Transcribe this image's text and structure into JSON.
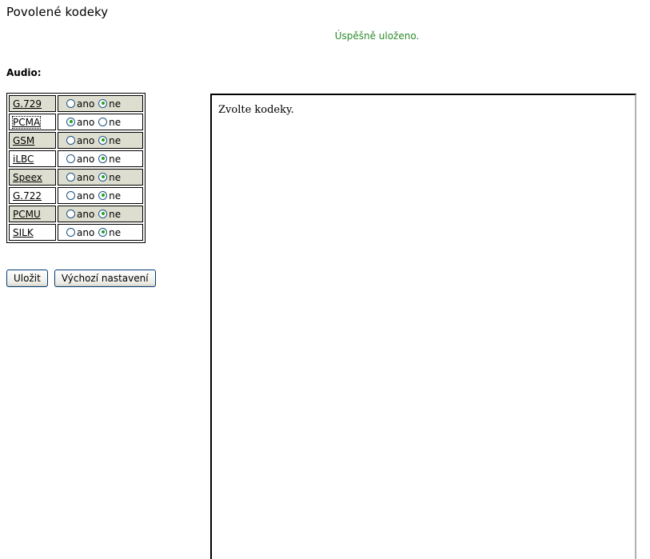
{
  "page": {
    "title": "Povolené kodeky",
    "status_message": "Úspěšně uloženo.",
    "status_color": "#2a8a2a"
  },
  "audio": {
    "section_title": "Audio:",
    "option_yes": "ano",
    "option_no": "ne",
    "codecs": [
      {
        "name": "G.729",
        "enabled": false
      },
      {
        "name": "PCMA",
        "enabled": true
      },
      {
        "name": "GSM",
        "enabled": false
      },
      {
        "name": "iLBC",
        "enabled": false
      },
      {
        "name": "Speex",
        "enabled": false
      },
      {
        "name": "G.722",
        "enabled": false
      },
      {
        "name": "PCMU",
        "enabled": false
      },
      {
        "name": "SILK",
        "enabled": false
      }
    ]
  },
  "buttons": {
    "save_label": "Uložit",
    "defaults_label": "Výchozí nastavení"
  },
  "help_panel": {
    "text": "Zvolte kodeky."
  }
}
